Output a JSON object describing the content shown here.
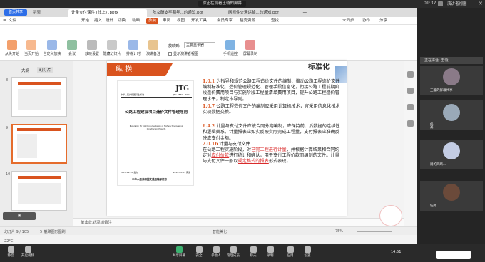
{
  "meeting": {
    "share_banner": "你正在观看王璇的屏幕",
    "time": "01:32",
    "view_button": "演讲者视图",
    "speaker_label": "正在讲话: 王璇;"
  },
  "tabs": [
    {
      "label": "首页共享"
    },
    {
      "label": "稻壳"
    },
    {
      "label": "计量支付课件 (线上) .pptx"
    },
    {
      "label": "陈女酬支牢期年...的通知.pdf"
    },
    {
      "label": "网附件交通运输...的通知.pdf"
    }
  ],
  "menu": [
    "文件",
    "开始",
    "插入",
    "设计",
    "切换",
    "动画",
    "放映",
    "审阅",
    "视图",
    "开发工具",
    "会员专享",
    "稻壳资源"
  ],
  "menu_active": "放映",
  "menu_right": {
    "search": "查找",
    "cloud": "未同步",
    "collab": "协作",
    "share": "分享"
  },
  "ribbon": {
    "buttons": [
      "从头开始",
      "当页开始",
      "自定义放映",
      "会议",
      "放映设置",
      "隐藏幻灯片",
      "排练计时",
      "演讲备注"
    ],
    "monitor_label": "放映到:",
    "monitor_value": "主要显示器",
    "presenter_view": "显示演讲者视图",
    "extra_buttons": [
      "手机遥控",
      "屏幕录制"
    ]
  },
  "sidebar": {
    "tabs": [
      "大纲",
      "幻灯片"
    ],
    "slide_numbers": [
      "8",
      "9",
      "10"
    ]
  },
  "slide": {
    "header": "纵 横",
    "title_top": "标准化",
    "book": {
      "code": "JTG",
      "publisher_line": "中华人民共和国行业标准",
      "number": "JTG 3830—2007",
      "title": "公路工程建设项目造价文件管理导则",
      "english": "Regulation for Cost Documentation of Highway Engineering Construction Projects",
      "dates": "2017-12-18 发布",
      "dates2": "2018-02-01 实施",
      "issuer": "中华人民共和国交通运输部发布"
    },
    "p1_num": "1.0.1",
    "p1": "为指导和规范公路工程造价文件的编制、推动公路工程造价文件编制标准化、造价管理规范化、管理手段信息化，衔接公路工程前期阶段造价费用项目与实施阶段工程量清单费用项目，提升公路工程造价管理水平，制定本导则。",
    "p2_num": "1.0.7",
    "p2": "公路工程造价文件的编制应采用计算机技术，宜采用信息化技术实现数据交换。",
    "p3_num": "6.4.2",
    "p3": "计量与支付文件应按合同分期编制，应保持前、后数据的连续性和逻辑关系。计量报表应如实反映实际完成工程量，支付报表应准确反映应支付金额。",
    "p4_num": "2.0.16",
    "p4_title": "计量与支付文件",
    "p4a": "在公路工程实施阶段，对",
    "p4b": "已完工程进行计量",
    "p4c": "，并根据计算结果和合同约定对",
    "p4d": "应付价款",
    "p4e": "进行统计和确认，用于支付工程价款而编制的文件。计量与支付文件一般以",
    "p4f": "规定格式的报表",
    "p4g": "形式表现。"
  },
  "notes_placeholder": "单击此处添加备注",
  "status": {
    "slide": "幻灯片 9 / 105",
    "theme": "5_魅联图形图刷",
    "smart": "智能美化",
    "zoom": "75%"
  },
  "participants": [
    {
      "name": "王璇的屏幕共享"
    },
    {
      "name": "佟"
    },
    {
      "name": "高"
    },
    {
      "name": "周的风断..."
    },
    {
      "name": "任婷"
    }
  ],
  "taskbar": {
    "left": [
      "静音",
      "开启视频"
    ],
    "center": [
      "共享屏幕",
      "安全",
      "参会人",
      "管理成员",
      "聊天",
      "录制",
      "应用",
      "设置"
    ],
    "weather": "22°C",
    "clock": "14:51"
  }
}
